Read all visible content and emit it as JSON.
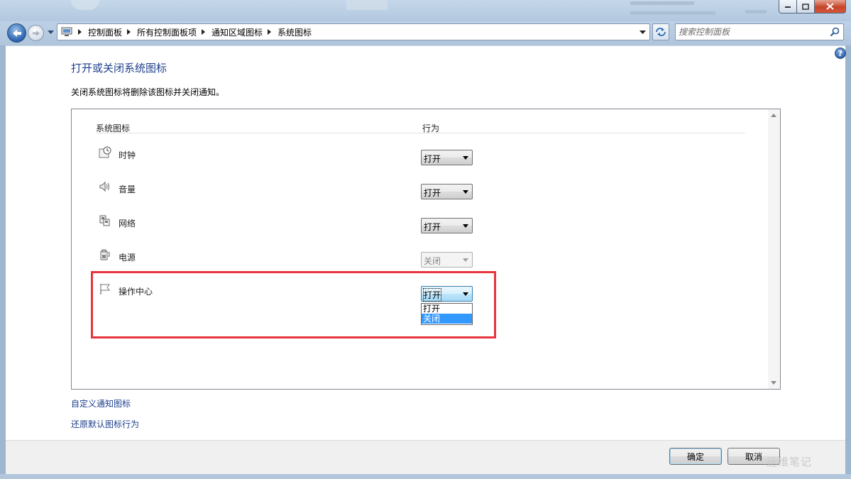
{
  "window": {
    "caption_buttons": [
      "minimize",
      "maximize",
      "close"
    ]
  },
  "nav": {
    "breadcrumbs": [
      "控制面板",
      "所有控制面板项",
      "通知区域图标",
      "系统图标"
    ],
    "search_placeholder": "搜索控制面板"
  },
  "content": {
    "title": "打开或关闭系统图标",
    "description": "关闭系统图标将删除该图标并关闭通知。",
    "columns": {
      "icon": "系统图标",
      "behavior": "行为"
    },
    "rows": [
      {
        "label": "时钟",
        "value": "打开",
        "icon": "clock-icon",
        "enabled": true
      },
      {
        "label": "音量",
        "value": "打开",
        "icon": "volume-icon",
        "enabled": true
      },
      {
        "label": "网络",
        "value": "打开",
        "icon": "network-icon",
        "enabled": true
      },
      {
        "label": "电源",
        "value": "关闭",
        "icon": "power-icon",
        "enabled": false
      },
      {
        "label": "操作中心",
        "value": "打开",
        "icon": "flag-icon",
        "enabled": true
      }
    ],
    "dropdown_open": {
      "row": "操作中心",
      "options": [
        "打开",
        "关闭"
      ],
      "highlighted": "关闭"
    },
    "highlight_color": "#e8343c",
    "links": {
      "customize": "自定义通知图标",
      "restore": "还原默认图标行为"
    }
  },
  "footer": {
    "ok_label": "确定",
    "cancel_label": "取消",
    "watermark": "运维笔记"
  },
  "colors": {
    "link": "#1e3f8c",
    "title": "#1e3f8c",
    "selection": "#3399ff"
  }
}
